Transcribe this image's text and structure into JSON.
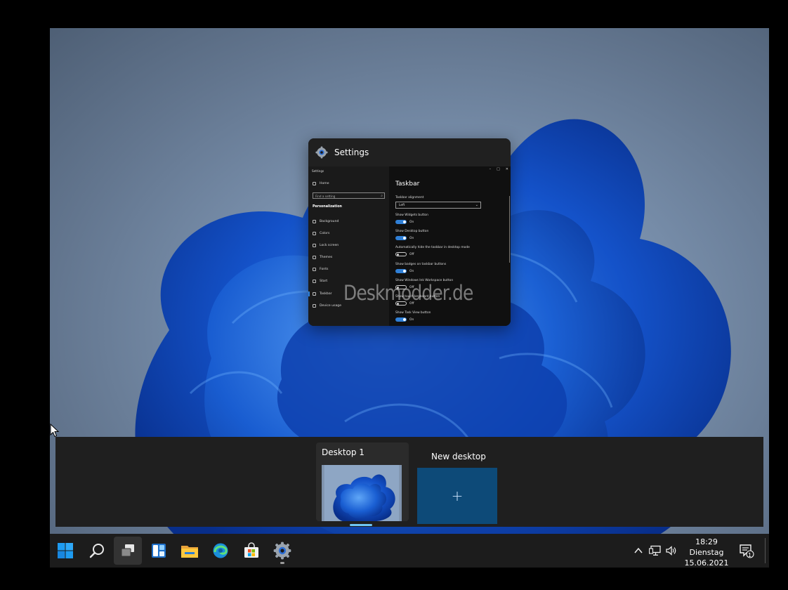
{
  "settings_window": {
    "title": "Settings",
    "thumbnail": {
      "app_label": "Settings",
      "nav_home": "Home",
      "search_placeholder": "Find a setting",
      "section": "Personalization",
      "nav": [
        "Background",
        "Colors",
        "Lock screen",
        "Themes",
        "Fonts",
        "Start",
        "Taskbar",
        "Device usage"
      ],
      "page_title": "Taskbar",
      "alignment_label": "Taskbar alignment",
      "alignment_value": "Left",
      "options": [
        {
          "label": "Show Widgets button",
          "state": "On"
        },
        {
          "label": "Show Desktop button",
          "state": "On"
        },
        {
          "label": "Automatically hide the taskbar in desktop mode",
          "state": "Off"
        },
        {
          "label": "Show badges on taskbar buttons",
          "state": "On"
        },
        {
          "label": "Show Windows Ink Workspace button",
          "state": "Off"
        },
        {
          "label": "Show touch keyboard button",
          "state": "Off"
        },
        {
          "label": "Show Task View button",
          "state": "On"
        }
      ]
    }
  },
  "watermark": "Deskmodder.de",
  "desktops": {
    "items": [
      {
        "label": "Desktop 1",
        "active": true
      }
    ],
    "new_desktop_label": "New desktop",
    "new_desktop_glyph": "+"
  },
  "taskbar": {
    "icons": [
      "windows-start-icon",
      "search-icon",
      "task-view-icon",
      "widgets-icon",
      "file-explorer-icon",
      "edge-icon",
      "store-icon",
      "settings-icon"
    ],
    "clock": {
      "time": "18:29",
      "day": "Dienstag",
      "date": "15.06.2021"
    },
    "notification_count": "1"
  },
  "colors": {
    "accent": "#2f7fd6",
    "taskbar": "#1c1c1c",
    "new_desktop_tile": "#0d4a78"
  }
}
